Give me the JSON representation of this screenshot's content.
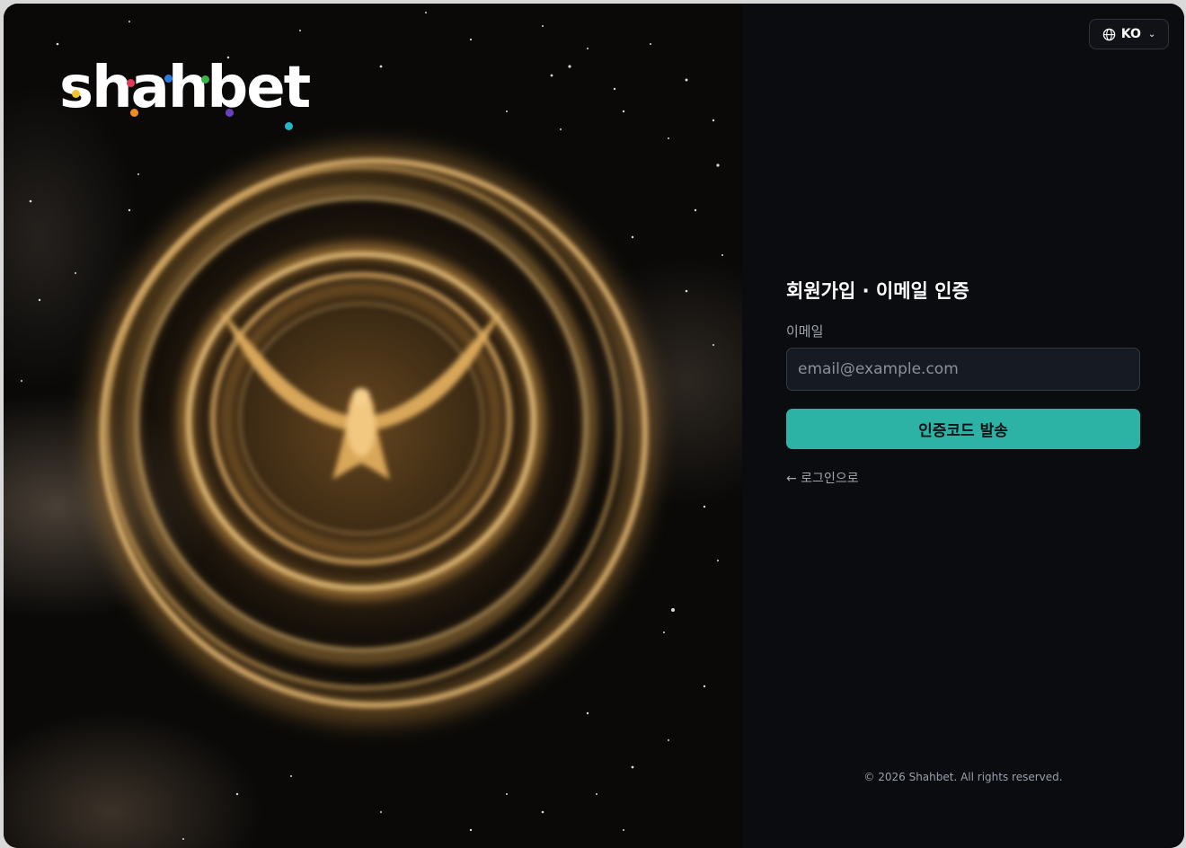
{
  "brand": {
    "logo_text": "shahbet",
    "dot_colors": [
      "#f2c230",
      "#e23b5a",
      "#2d7be0",
      "#39b54a",
      "#f08a24",
      "#6a3fc2",
      "#22b8c9"
    ]
  },
  "header": {
    "language_code": "KO",
    "globe_icon": "globe-icon",
    "chevron_icon": "chevron-down-icon"
  },
  "form": {
    "title": "회원가입 · 이메일 인증",
    "email_label": "이메일",
    "email_placeholder": "email@example.com",
    "email_value": "",
    "submit_label": "인증코드 발송",
    "back_link": "← 로그인으로"
  },
  "footer": {
    "copyright": "© 2026 Shahbet. All rights reserved."
  },
  "colors": {
    "accent": "#2db3a6",
    "panel_bg": "#0b0c10",
    "input_bg": "#161a22",
    "gold": "#e7b96a"
  }
}
